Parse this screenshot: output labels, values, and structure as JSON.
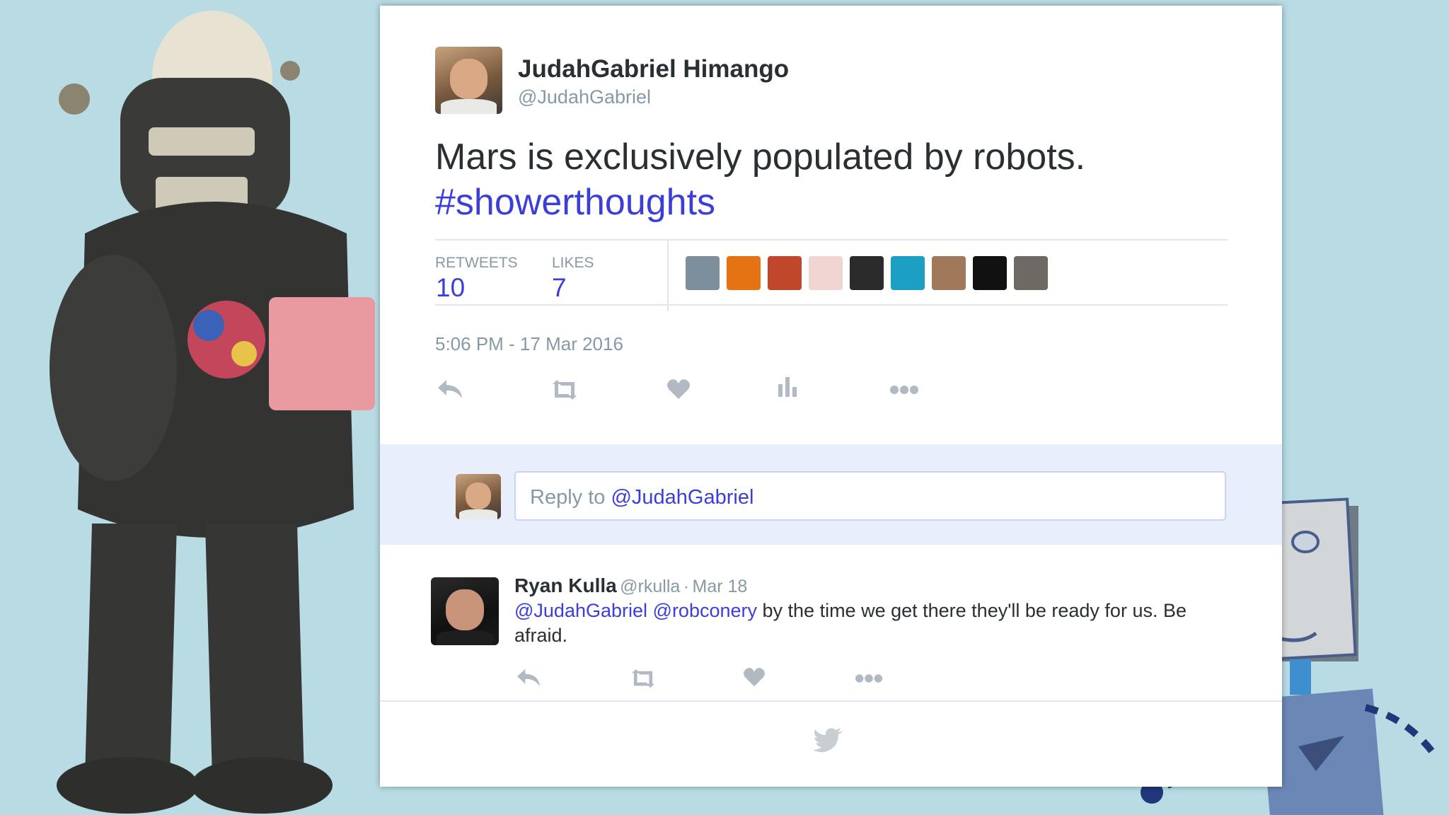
{
  "tweet": {
    "author_name": "JudahGabriel Himango",
    "author_handle": "@JudahGabriel",
    "text": "Mars is exclusively populated by robots.",
    "hashtag": "#showerthoughts",
    "timestamp": "5:06 PM - 17 Mar 2016",
    "stats": {
      "retweets_label": "RETWEETS",
      "retweets_value": "10",
      "likes_label": "LIKES",
      "likes_value": "7"
    },
    "likers": [
      {
        "name": "liker-1",
        "color": "#7d8f9c"
      },
      {
        "name": "liker-2",
        "color": "#e67312"
      },
      {
        "name": "liker-3",
        "color": "#c0472c"
      },
      {
        "name": "liker-4",
        "color": "#f1d5d3"
      },
      {
        "name": "liker-5",
        "color": "#2b2b2b"
      },
      {
        "name": "liker-6",
        "color": "#1b9fc2"
      },
      {
        "name": "liker-7",
        "color": "#a0785a"
      },
      {
        "name": "liker-8",
        "color": "#111111"
      },
      {
        "name": "liker-9",
        "color": "#6d6a66"
      }
    ],
    "actions": [
      "reply-icon",
      "retweet-icon",
      "like-icon",
      "analytics-icon",
      "more-icon"
    ]
  },
  "reply_composer": {
    "prefix": "Reply to ",
    "mention": "@JudahGabriel"
  },
  "reply": {
    "name": "Ryan Kulla",
    "handle": "@rkulla",
    "separator": "·",
    "date": "Mar 18",
    "mention_1": "@JudahGabriel",
    "mention_2": "@robconery",
    "text": " by the time we get there they'll be ready for us. Be afraid.",
    "actions": [
      "reply-icon",
      "retweet-icon",
      "like-icon",
      "more-icon"
    ]
  },
  "colors": {
    "background": "#b8dbe4",
    "link": "#3b3fd8",
    "muted": "#8899a6",
    "text": "#292f33",
    "reply_area": "#e8eefb"
  }
}
